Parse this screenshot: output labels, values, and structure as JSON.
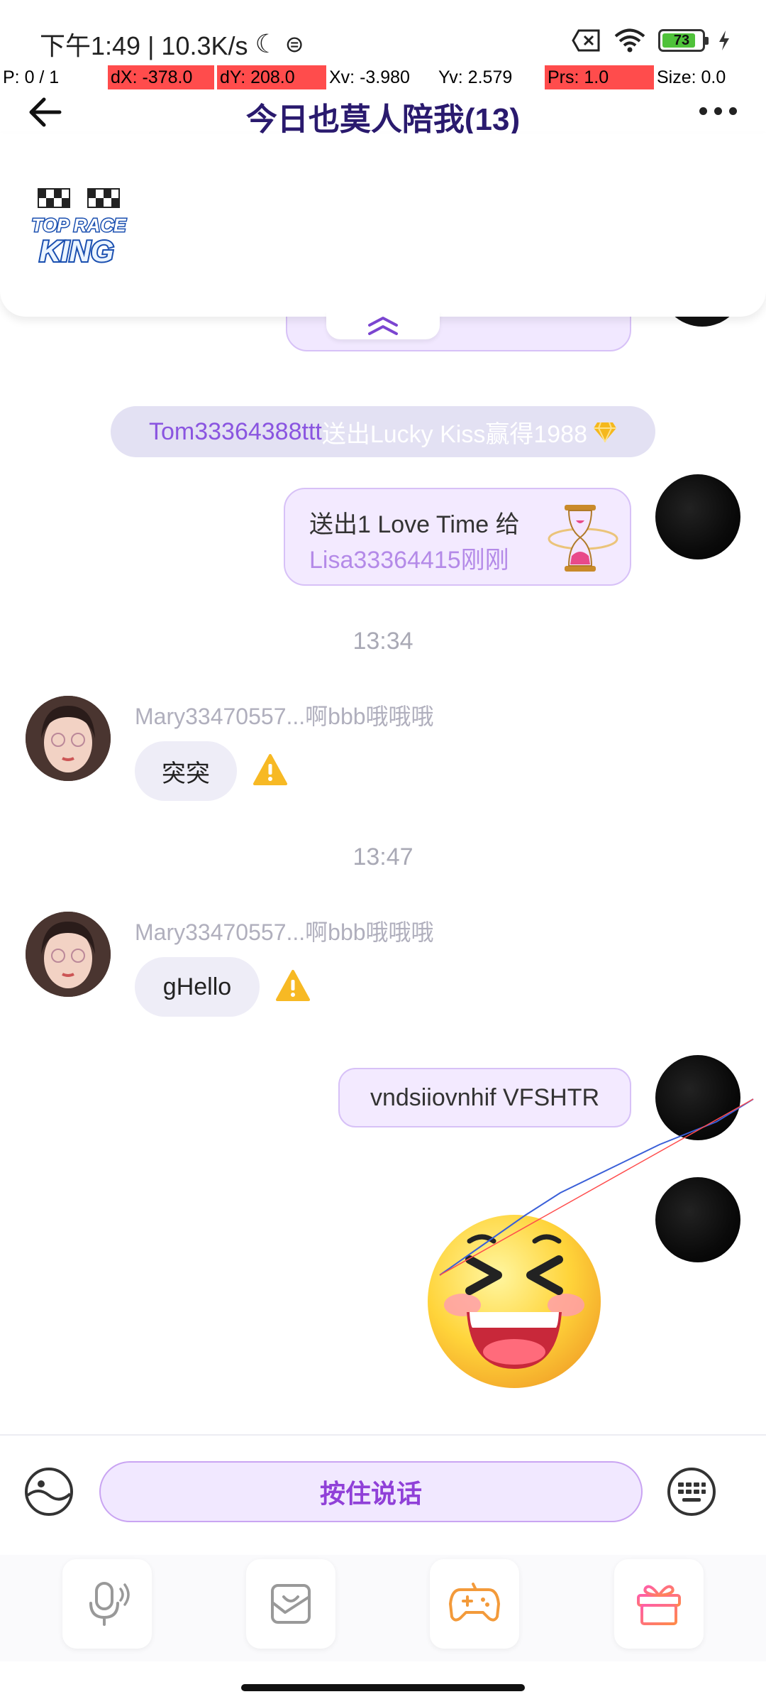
{
  "status_bar": {
    "time_speed": "下午1:49 | 10.3K/s",
    "battery": "73"
  },
  "debug_overlay": {
    "p": "P: 0 / 1",
    "dx": "dX: -378.0",
    "dy": "dY: 208.0",
    "xv": "Xv: -3.980",
    "yv": "Yv: 2.579",
    "prs": "Prs: 1.0",
    "size": "Size: 0.0"
  },
  "header": {
    "title": "今日也莫人陪我(13)"
  },
  "pinned": {
    "logo_text_top": "TOP RACE",
    "logo_text_bottom": "KING"
  },
  "messages": {
    "system_notice": {
      "name": "Tom33364388ttt",
      "text": "送出Lucky Kiss赢得1988"
    },
    "gift_message": {
      "line1": "送出1 Love Time 给",
      "line2": "Lisa33364415刚刚"
    },
    "timestamp1": "13:34",
    "msg1": {
      "sender": "Mary33470557...啊bbb哦哦哦",
      "text": "突突"
    },
    "timestamp2": "13:47",
    "msg2": {
      "sender": "Mary33470557...啊bbb哦哦哦",
      "text": "gHello"
    },
    "msg3": {
      "text": "vndsiiovnhif VFSHTR"
    }
  },
  "input": {
    "hold_to_talk": "按住说话"
  },
  "colors": {
    "accent": "#9040d8",
    "bubble_self": "#f3eaff",
    "bubble_other": "#eeedf7",
    "warning": "#f7b924"
  },
  "icons": [
    "back-arrow-icon",
    "more-icon",
    "chevron-up-icon",
    "gem-icon",
    "warning-icon",
    "sticker-icon",
    "keyboard-icon",
    "microphone-icon",
    "photo-icon",
    "gamepad-icon",
    "gift-icon"
  ]
}
